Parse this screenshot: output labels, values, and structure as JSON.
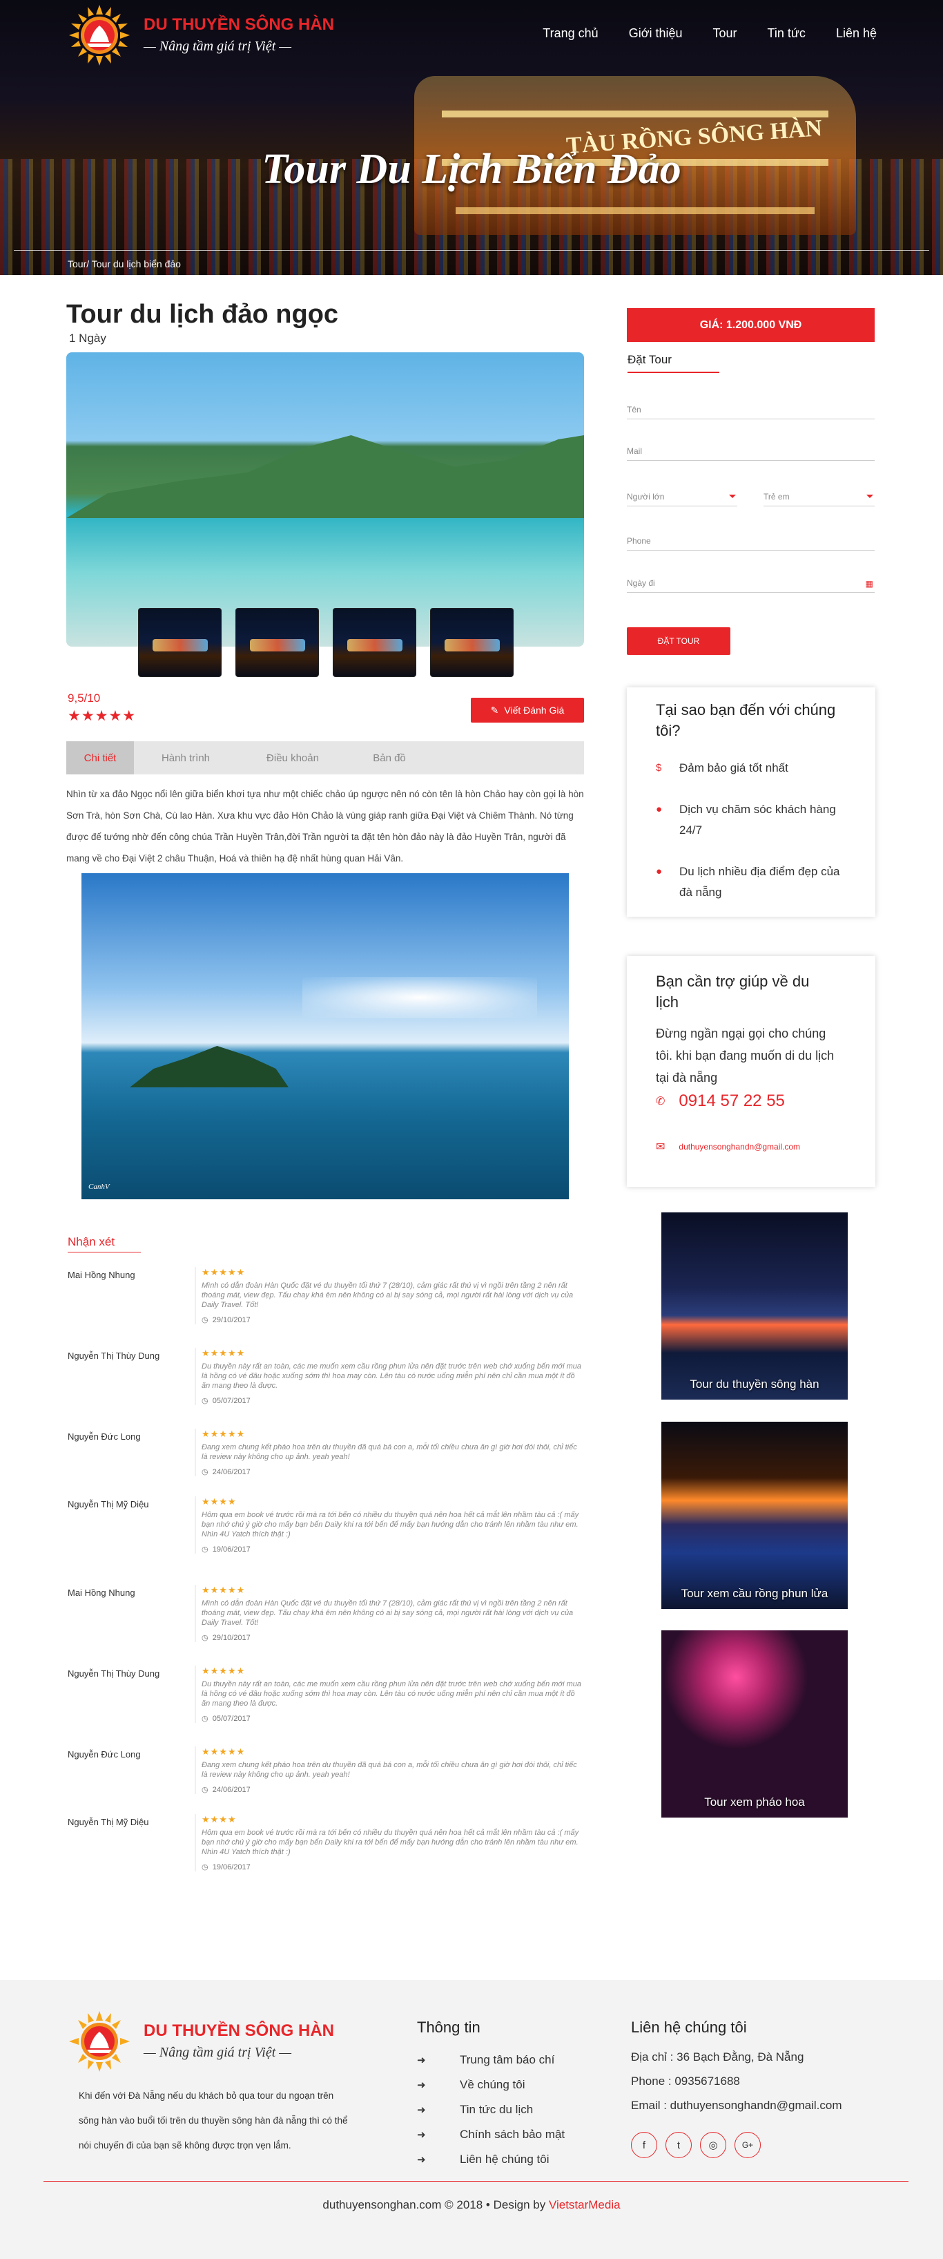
{
  "brand": {
    "name": "DU THUYỀN SÔNG HÀN",
    "slogan": "— Nâng tầm giá trị Việt —"
  },
  "nav": [
    "Trang chủ",
    "Giới thiệu",
    "Tour",
    "Tin tức",
    "Liên hệ"
  ],
  "hero": {
    "title": "Tour Du Lịch Biển Đảo",
    "boat_sign": "TÀU RỒNG SÔNG HÀN",
    "breadcrumb": "Tour/ Tour du lịch biển đảo"
  },
  "tour": {
    "title": "Tour du lịch đảo ngọc",
    "duration": "1 Ngày",
    "rating": "9,5/10",
    "stars": "★★★★★",
    "review_button": "Viết Đánh Giá",
    "tabs": [
      "Chi tiết",
      "Hành trình",
      "Điều khoản",
      "Bản đồ"
    ],
    "description": "Nhìn từ xa đảo Ngọc nổi lên giữa biển khơi tựa như một chiếc chảo úp ngược nên nó còn tên là hòn Chảo hay còn gọi là hòn Sơn Trà, hòn Sơn Chà, Cù lao Hàn. Xưa khu vực đảo Hòn Chảo là vùng giáp ranh giữa Đại Việt và Chiêm Thành. Nó từng được đế tướng nhờ đến công chúa Trần Huyền Trân,đời Trần người ta đặt tên hòn đảo này là đảo Huyền Trân, người đã mang về cho Đại Việt 2 châu Thuận, Hoá và thiên hạ đệ nhất hùng quan Hải Vân.",
    "photo_signature": "CanhV"
  },
  "comments": {
    "heading": "Nhận xét",
    "items": [
      {
        "name": "Mai Hồng Nhung",
        "stars": "★★★★★",
        "text": "Mình có dẫn đoàn Hàn Quốc đặt vé du thuyền tối thứ 7 (28/10), cảm giác rất thú vị vì ngồi trên tầng 2 nên rất thoáng mát, view đẹp. Tấu chay khá êm nên không có ai bị say sóng cả, mọi người rất hài lòng với dịch vụ của Daily Travel. Tốt!",
        "date": "29/10/2017"
      },
      {
        "name": "Nguyễn Thị Thùy Dung",
        "stars": "★★★★★",
        "text": "Du thuyền này rất an toàn, các me muốn xem cầu rồng phun lửa nên đặt trước trên web chớ xuống bến mới mua là hồng có vé đâu hoặc xuống sớm thì hoa may còn. Lên tàu có nước uống miễn phí nên chỉ cần mua một ít đồ ăn mang theo là được.",
        "date": "05/07/2017"
      },
      {
        "name": "Nguyễn Đức Long",
        "stars": "★★★★★",
        "text": "Đang xem chung kết pháo hoa trên du thuyền đã quá bá con a, mỗi tối chiều chưa ăn gì giờ hơi đói thôi, chỉ tiếc là review này không cho up ảnh. yeah yeah!",
        "date": "24/06/2017"
      },
      {
        "name": "Nguyễn Thị Mỹ Diệu",
        "stars": "★★★★",
        "text": "Hôm qua em book vé trước rồi mà ra tới bến có nhiều du thuyền quá nên hoa hết cả mắt lên nhầm tàu cả :( mấy bạn nhớ chú ý giờ cho mấy bạn bến Daily khi ra tới bến để mấy bạn hướng dẫn cho tránh lên nhầm tàu như em. Nhìn 4U Yatch thích thật :)",
        "date": "19/06/2017"
      },
      {
        "name": "Mai Hồng Nhung",
        "stars": "★★★★★",
        "text": "Mình có dẫn đoàn Hàn Quốc đặt vé du thuyền tối thứ 7 (28/10), cảm giác rất thú vị vì ngồi trên tầng 2 nên rất thoáng mát, view đẹp. Tấu chay khá êm nên không có ai bị say sóng cả, mọi người rất hài lòng với dịch vụ của Daily Travel. Tốt!",
        "date": "29/10/2017"
      },
      {
        "name": "Nguyễn Thị Thùy Dung",
        "stars": "★★★★★",
        "text": "Du thuyền này rất an toàn, các me muốn xem cầu rồng phun lửa nên đặt trước trên web chớ xuống bến mới mua là hồng có vé đâu hoặc xuống sớm thì hoa may còn. Lên tàu có nước uống miễn phí nên chỉ cần mua một ít đồ ăn mang theo là được.",
        "date": "05/07/2017"
      },
      {
        "name": "Nguyễn Đức Long",
        "stars": "★★★★★",
        "text": "Đang xem chung kết pháo hoa trên du thuyền đã quá bá con a, mỗi tối chiều chưa ăn gì giờ hơi đói thôi, chỉ tiếc là review này không cho up ảnh. yeah yeah!",
        "date": "24/06/2017"
      },
      {
        "name": "Nguyễn Thị Mỹ Diệu",
        "stars": "★★★★",
        "text": "Hôm qua em book vé trước rồi mà ra tới bến có nhiều du thuyền quá nên hoa hết cả mắt lên nhầm tàu cả :( mấy bạn nhớ chú ý giờ cho mấy bạn bến Daily khi ra tới bến để mấy bạn hướng dẫn cho tránh lên nhầm tàu như em. Nhìn 4U Yatch thích thật :)",
        "date": "19/06/2017"
      }
    ]
  },
  "booking": {
    "price": "GIÁ: 1.200.000 VNĐ",
    "title": "Đặt Tour",
    "name_placeholder": "Tên",
    "mail_placeholder": "Mail",
    "adults_label": "Người lớn",
    "children_label": "Trẻ em",
    "phone_placeholder": "Phone",
    "date_placeholder": "Ngày đi",
    "submit": "ĐẶT TOUR"
  },
  "why": {
    "title": "Tại sao bạn đến với chúng tôi?",
    "reasons": [
      {
        "icon": "dollar-icon",
        "glyph": "$",
        "text": "Đảm bảo giá tốt nhất"
      },
      {
        "icon": "user-icon",
        "glyph": "●",
        "text": "Dịch vụ chăm sóc khách hàng 24/7"
      },
      {
        "icon": "user-icon",
        "glyph": "●",
        "text": "Du lịch nhiều địa điểm đẹp của đà nẵng"
      }
    ]
  },
  "help": {
    "title": "Bạn cần trợ giúp về du lịch",
    "text": "Đừng ngần ngại gọi cho chúng tôi. khi bạn đang muốn di du lịch tại đà nẵng",
    "phone": "0914 57 22 55",
    "email": "duthuyensonghandn@gmail.com"
  },
  "promos": [
    "Tour du thuyền sông hàn",
    "Tour xem cầu rồng phun lửa",
    "Tour xem pháo hoa"
  ],
  "footer": {
    "desc": "Khi đến với Đà Nẵng nếu du khách bỏ qua tour du ngoạn trên sông hàn vào buổi tối trên du thuyền sông hàn đà nẵng thì có thể nói chuyến đi của bạn sẽ không được trọn vẹn lắm.",
    "info_title": "Thông tin",
    "info_links": [
      "Trung tâm báo chí",
      "Về chúng tôi",
      "Tin tức du lịch",
      "Chính sách bảo mật",
      "Liên hệ chúng tôi"
    ],
    "contact_title": "Liên hệ chúng tôi",
    "address": "Địa chỉ : 36 Bạch Đằng, Đà Nẵng",
    "phone": "Phone : 0935671688",
    "email": "Email : duthuyensonghandn@gmail.com",
    "social": [
      {
        "icon": "facebook-icon",
        "glyph": "f"
      },
      {
        "icon": "twitter-icon",
        "glyph": "t"
      },
      {
        "icon": "instagram-icon",
        "glyph": "◎"
      },
      {
        "icon": "google-plus-icon",
        "glyph": "G+"
      }
    ],
    "copyright": "duthuyensonghan.com © 2018 • Design by ",
    "designer": "VietstarMedia"
  },
  "colors": {
    "accent": "#e8262a",
    "star": "#f3a521"
  }
}
